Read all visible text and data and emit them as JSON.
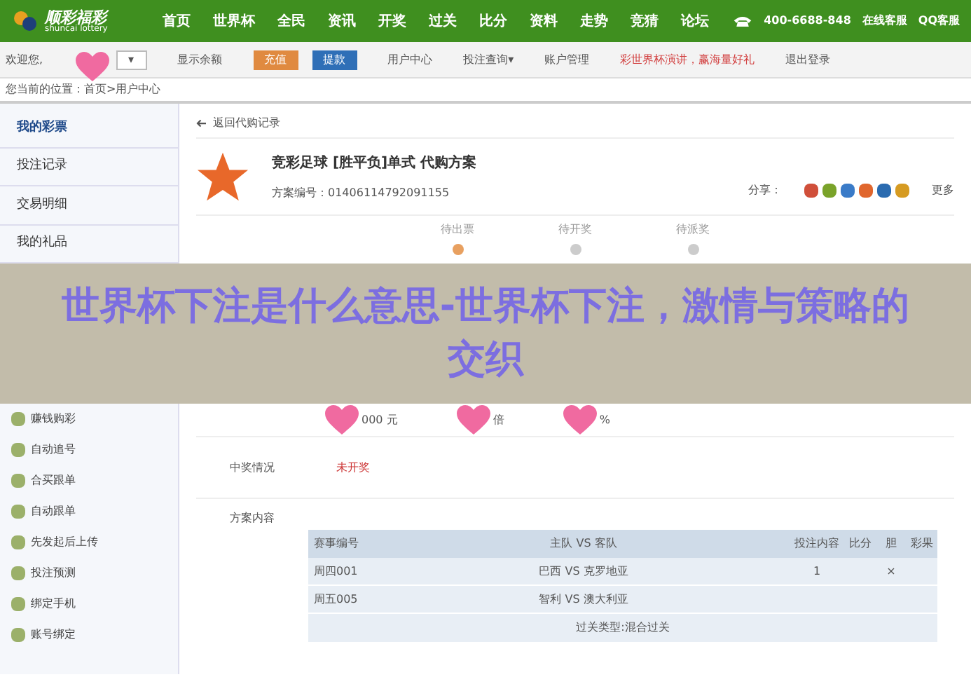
{
  "header": {
    "logo_text": "顺彩福彩",
    "logo_sub": "shuncai lottery",
    "nav": [
      {
        "label": "首页",
        "selected": false
      },
      {
        "label": "世界杯",
        "selected": false
      },
      {
        "label": "全民",
        "selected": false
      },
      {
        "label": "资讯",
        "selected": false
      },
      {
        "label": "开奖",
        "selected": false
      },
      {
        "label": "过关",
        "selected": false
      },
      {
        "label": "比分",
        "selected": false
      },
      {
        "label": "资料",
        "selected": false
      },
      {
        "label": "走势",
        "selected": false
      },
      {
        "label": "竞猜",
        "selected": false
      },
      {
        "label": "论坛",
        "selected": false
      }
    ],
    "phone": "400-6688-848",
    "links": [
      "在线客服",
      "QQ客服"
    ]
  },
  "userbar": {
    "welcome": "欢迎您,",
    "user": "▾",
    "balance": "显示余额",
    "deposit": "充值",
    "withdraw": "提款",
    "items": [
      "用户中心",
      "投注查询▾",
      "账户管理"
    ],
    "promo": "彩世界杯演讲，赢海量好礼",
    "logout": "退出登录"
  },
  "breadcrumb": "您当前的位置：首页>用户中心",
  "sidebar": {
    "main": [
      {
        "label": "我的彩票",
        "selected": true
      },
      {
        "label": "投注记录",
        "selected": false
      },
      {
        "label": "交易明细",
        "selected": false
      },
      {
        "label": "我的礼品",
        "selected": false
      }
    ],
    "services": [
      "赚钱购彩",
      "自动追号",
      "合买跟单",
      "自动跟单",
      "先发起后上传",
      "投注预测",
      "绑定手机",
      "账号绑定"
    ]
  },
  "main": {
    "back": "返回代购记录",
    "title": "竞彩足球 [胜平负]单式 代购方案",
    "plan_no": "方案编号：01406114792091155",
    "share": "分享：",
    "share_end": "更多",
    "steps": [
      {
        "label": "待出票",
        "selected": true
      },
      {
        "label": "待开奖",
        "selected": false
      },
      {
        "label": "待派奖",
        "selected": false
      }
    ],
    "basic": [
      "000 元",
      "倍",
      "%"
    ],
    "win_label": "中奖情况",
    "win_value": "未开奖",
    "content_label": "方案内容",
    "table": {
      "columns": [
        "赛事编号",
        "主队 VS 客队",
        "投注内容",
        "比分",
        "胆",
        "彩果"
      ],
      "rows": [
        [
          "周四001",
          "巴西 VS 克罗地亚",
          "1",
          "",
          "×",
          ""
        ],
        [
          "周五005",
          "智利 VS 澳大利亚",
          "",
          "",
          "",
          ""
        ]
      ],
      "footer": "过关类型:混合过关"
    }
  },
  "banner": {
    "title": "世界杯下注是什么意思-世界杯下注，激情与策略的交织"
  }
}
